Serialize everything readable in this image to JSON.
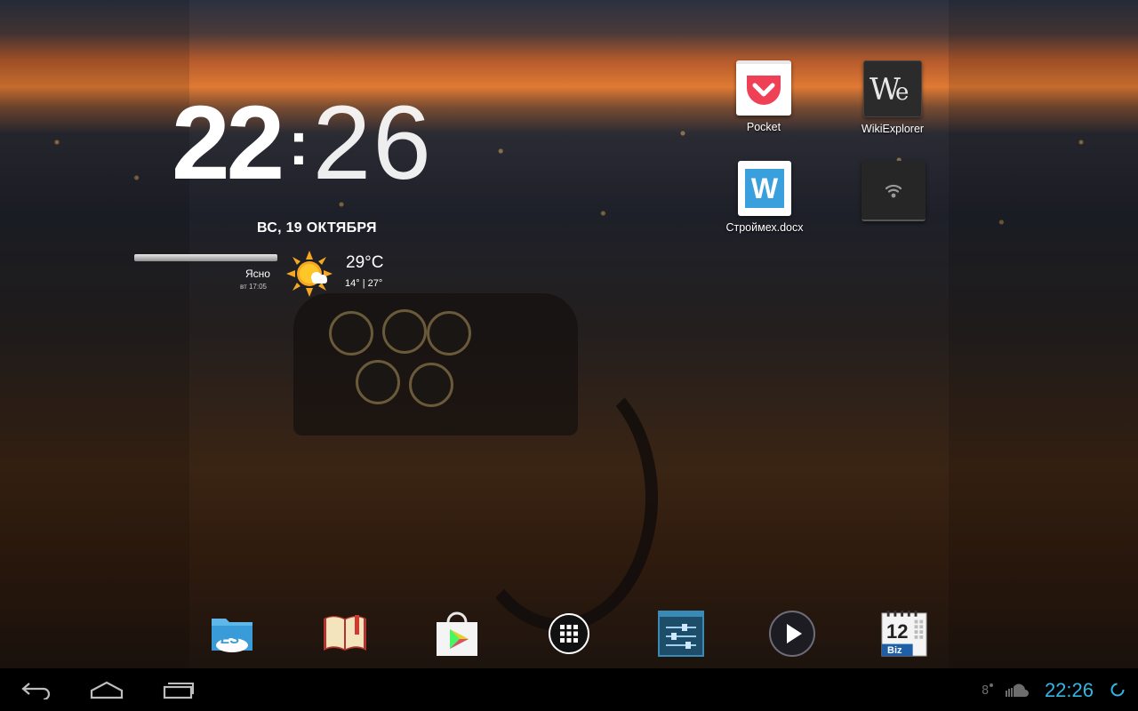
{
  "clock": {
    "hours": "22",
    "separator": ":",
    "minutes": "26"
  },
  "date": "ВС, 19 ОКТЯБРЯ",
  "weather": {
    "condition": "Ясно",
    "updated": "вт 17:05",
    "temperature": "29°C",
    "range": "14° | 27°"
  },
  "desktop_icons": [
    {
      "label": "Pocket",
      "icon": "pocket-icon"
    },
    {
      "label": "WikiExplorer",
      "icon": "wikiexplorer-icon"
    },
    {
      "label": "Строймех.docx",
      "icon": "word-doc-icon"
    },
    {
      "label": "",
      "icon": "wifi-widget-icon"
    }
  ],
  "dock": [
    {
      "name": "es-file-explorer",
      "icon": "es-file-explorer-icon"
    },
    {
      "name": "book-reader",
      "icon": "book-icon"
    },
    {
      "name": "play-store",
      "icon": "play-store-icon"
    },
    {
      "name": "app-drawer",
      "icon": "app-drawer-icon"
    },
    {
      "name": "settings",
      "icon": "settings-sliders-icon"
    },
    {
      "name": "media-player",
      "icon": "play-icon"
    },
    {
      "name": "business-calendar",
      "icon": "calendar-icon",
      "text": "12",
      "subtext": "Biz"
    }
  ],
  "status": {
    "time": "22:26",
    "accent": "#33b5e5"
  },
  "nav": {
    "back": "back-icon",
    "home": "home-icon",
    "recents": "recents-icon"
  }
}
